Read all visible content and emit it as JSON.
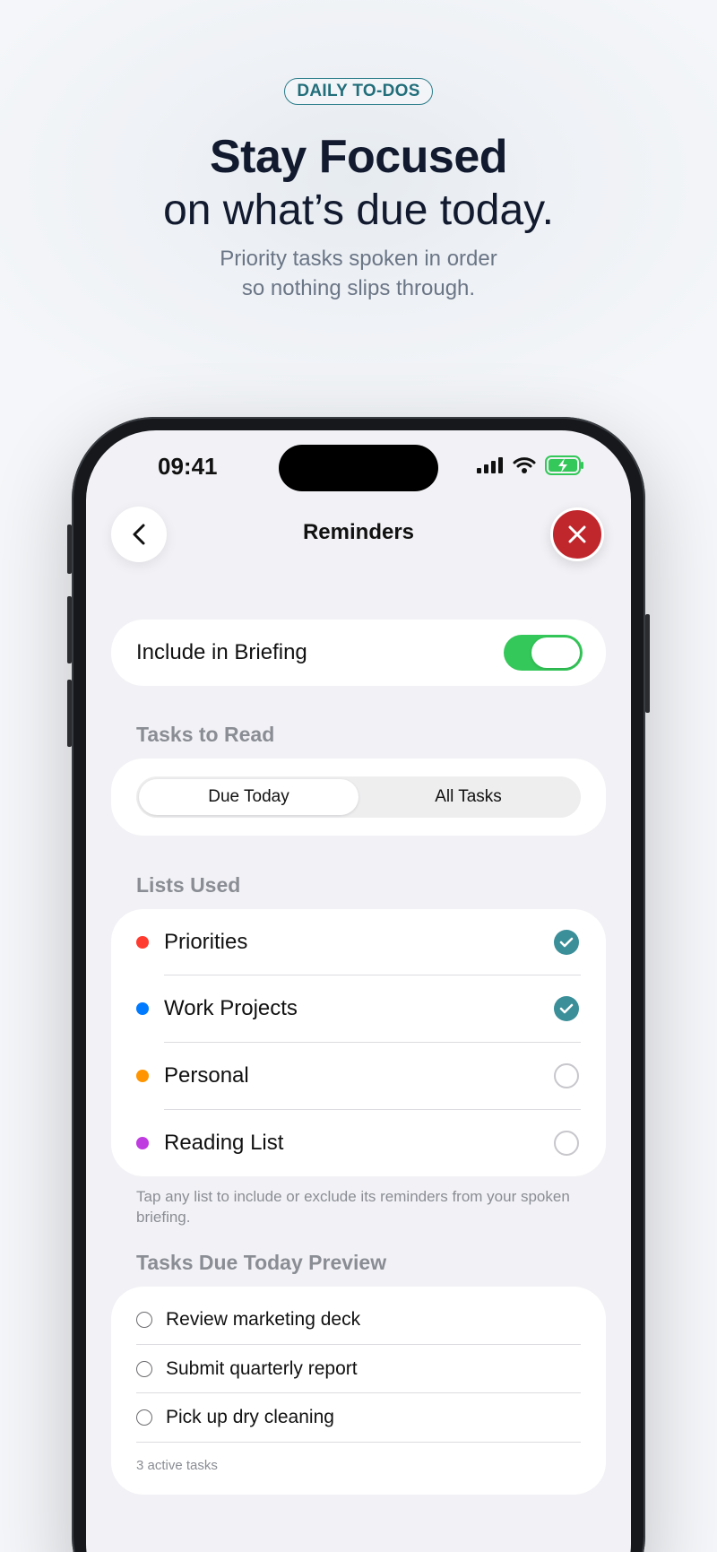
{
  "header": {
    "badge": "DAILY TO-DOS",
    "headline": "Stay Focused",
    "subheadline": "on what’s due today.",
    "tagline_line1": "Priority tasks spoken in order",
    "tagline_line2": "so nothing slips through."
  },
  "status_bar": {
    "time": "09:41",
    "icons": [
      "signal-icon",
      "wifi-icon",
      "battery-charging-icon"
    ]
  },
  "nav": {
    "title": "Reminders",
    "back_icon": "chevron-left-icon",
    "close_icon": "close-icon"
  },
  "briefing_toggle": {
    "label": "Include in Briefing",
    "on": true
  },
  "tasks_to_read": {
    "section_label": "Tasks to Read",
    "options": [
      "Due Today",
      "All Tasks"
    ],
    "selected": "Due Today"
  },
  "lists_used": {
    "section_label": "Lists Used",
    "items": [
      {
        "name": "Priorities",
        "color": "#ff3b30",
        "checked": true
      },
      {
        "name": "Work Projects",
        "color": "#007aff",
        "checked": true
      },
      {
        "name": "Personal",
        "color": "#ff9500",
        "checked": false
      },
      {
        "name": "Reading List",
        "color": "#bf3ce0",
        "checked": false
      }
    ],
    "help_text": "Tap any list to include or exclude its reminders from your spoken briefing."
  },
  "preview": {
    "section_label": "Tasks Due Today Preview",
    "tasks": [
      "Review marketing deck",
      "Submit quarterly report",
      "Pick up dry cleaning"
    ],
    "count_text": "3 active tasks"
  },
  "colors": {
    "accent": "#3b8f99",
    "toggle_on": "#34c759",
    "close": "#c0272d"
  }
}
